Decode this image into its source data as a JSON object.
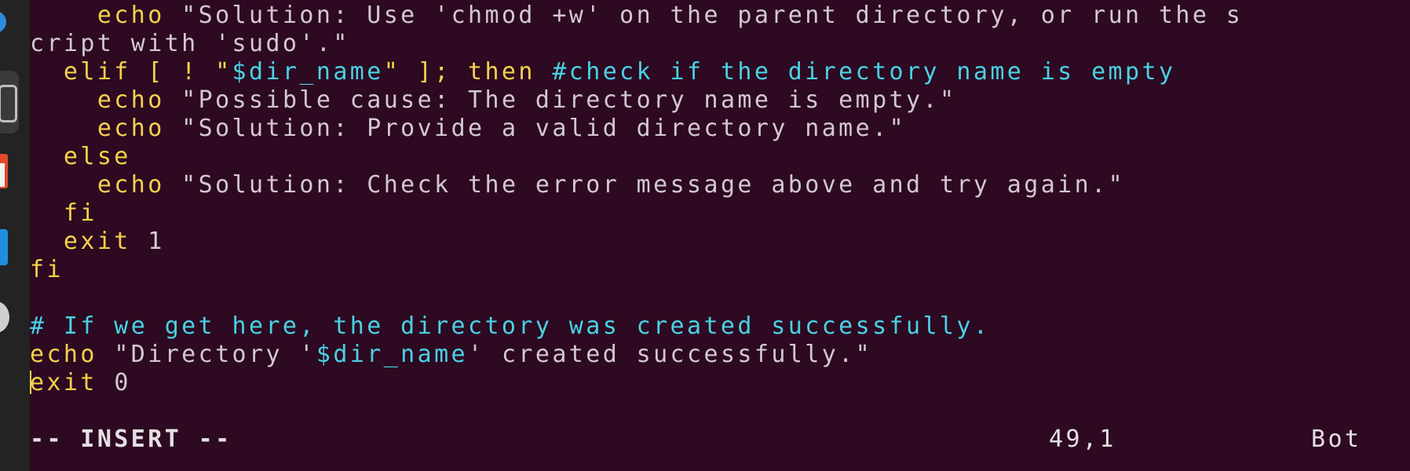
{
  "dock": {
    "items": [
      "browser-icon",
      "files-icon",
      "app-store-icon",
      "text-editor-icon",
      "disc-icon"
    ]
  },
  "editor": {
    "lines": [
      {
        "n": 1,
        "parts": [
          {
            "t": "    ",
            "c": "plain"
          },
          {
            "t": "echo",
            "c": "kw"
          },
          {
            "t": " \"Solution: Use 'chmod +w' on the parent directory, or run the s",
            "c": "str"
          }
        ]
      },
      {
        "n": 2,
        "parts": [
          {
            "t": "cript with 'sudo'.\"",
            "c": "str"
          }
        ]
      },
      {
        "n": 3,
        "parts": [
          {
            "t": "  elif [ ! \"",
            "c": "kw"
          },
          {
            "t": "$dir_name",
            "c": "var"
          },
          {
            "t": "\" ]; then ",
            "c": "kw"
          },
          {
            "t": "#check if the directory name is empty",
            "c": "com"
          }
        ]
      },
      {
        "n": 4,
        "parts": [
          {
            "t": "    ",
            "c": "plain"
          },
          {
            "t": "echo",
            "c": "kw"
          },
          {
            "t": " \"Possible cause: The directory name is empty.\"",
            "c": "str"
          }
        ]
      },
      {
        "n": 5,
        "parts": [
          {
            "t": "    ",
            "c": "plain"
          },
          {
            "t": "echo",
            "c": "kw"
          },
          {
            "t": " \"Solution: Provide a valid directory name.\"",
            "c": "str"
          }
        ]
      },
      {
        "n": 6,
        "parts": [
          {
            "t": "  else",
            "c": "kw"
          }
        ]
      },
      {
        "n": 7,
        "parts": [
          {
            "t": "    ",
            "c": "plain"
          },
          {
            "t": "echo",
            "c": "kw"
          },
          {
            "t": " \"Solution: Check the error message above and try again.\"",
            "c": "str"
          }
        ]
      },
      {
        "n": 8,
        "parts": [
          {
            "t": "  fi",
            "c": "kw"
          }
        ]
      },
      {
        "n": 9,
        "parts": [
          {
            "t": "  exit",
            "c": "kw"
          },
          {
            "t": " 1",
            "c": "str"
          }
        ]
      },
      {
        "n": 10,
        "parts": [
          {
            "t": "fi",
            "c": "kw"
          }
        ]
      },
      {
        "n": 11,
        "parts": []
      },
      {
        "n": 12,
        "parts": [
          {
            "t": "# If we get here, the directory was created successfully.",
            "c": "com"
          }
        ]
      },
      {
        "n": 13,
        "parts": [
          {
            "t": "echo",
            "c": "kw"
          },
          {
            "t": " \"Directory '",
            "c": "str"
          },
          {
            "t": "$dir_name",
            "c": "var"
          },
          {
            "t": "' created successfully.\"",
            "c": "str"
          }
        ]
      },
      {
        "n": 14,
        "cursor": true,
        "parts": [
          {
            "t": "exit",
            "c": "kw"
          },
          {
            "t": " 0",
            "c": "str"
          }
        ]
      }
    ]
  },
  "status": {
    "mode": "-- INSERT --",
    "position": "49,1",
    "scroll": "Bot"
  },
  "colors": {
    "background": "#2d0922",
    "keyword": "#f5d14b",
    "string": "#d3c8cf",
    "variable": "#49d2e3",
    "comment": "#49d2e3"
  }
}
